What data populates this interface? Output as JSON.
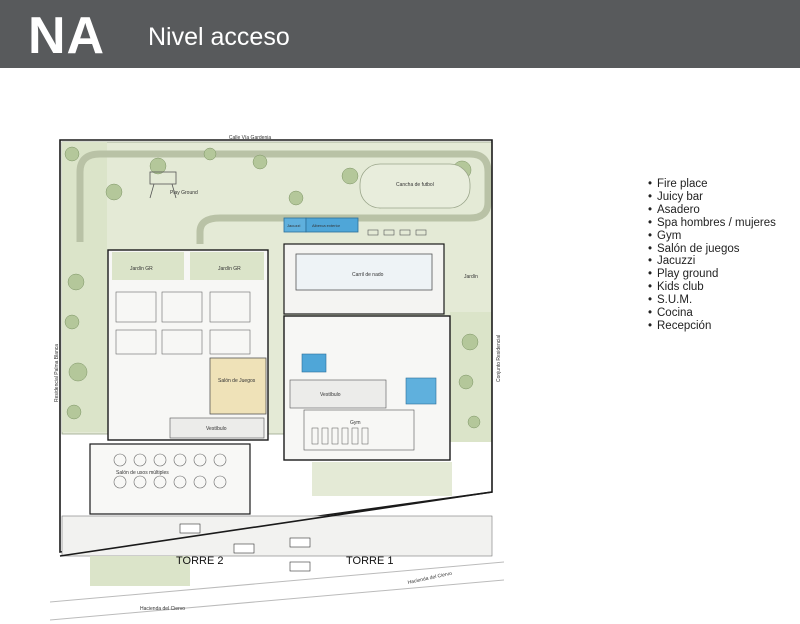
{
  "header": {
    "code": "NA",
    "title": "Nivel acceso"
  },
  "plan": {
    "labels": {
      "street_top": "Calle Vía Gardenia",
      "street_bottom_left": "Hacienda del Ciervo",
      "street_bottom_right": "Hacienda del Ciervo",
      "side_left": "Residencial Palma Blanca",
      "side_right": "Conjunto Residencial",
      "play_ground": "Play Ground",
      "cancha": "Cancha de futbol",
      "jacuzzi": "Jacuzzi",
      "alberca_ext": "Alberca exterior",
      "carril": "Carril de nado",
      "jardin_left": "Jardín GR",
      "jardin_mid": "Jardín GR",
      "jardin_right": "Jardín",
      "juegos": "Salón de Juegos",
      "vestibulo_left": "Vestíbulo",
      "vestibulo_right": "Vestíbulo",
      "salon_multiples": "Salón de usos múltiples",
      "gym": "Gym",
      "torre2": "TORRE 2",
      "torre1": "TORRE 1"
    }
  },
  "legend": {
    "items": [
      "Fire place",
      "Juicy bar",
      "Asadero",
      "Spa hombres / mujeres",
      "Gym",
      "Salón de juegos",
      "Jacuzzi",
      "Play ground",
      "Kids club",
      "S.U.M.",
      "Cocina",
      "Recepción"
    ]
  },
  "colors": {
    "header_bg": "#585a5c",
    "greenery": "#dfe6cf",
    "tree": "#a9bd8e",
    "pool": "#4fa6d8",
    "floor_highlight": "#efe2b8",
    "outline": "#1a1a1a"
  }
}
